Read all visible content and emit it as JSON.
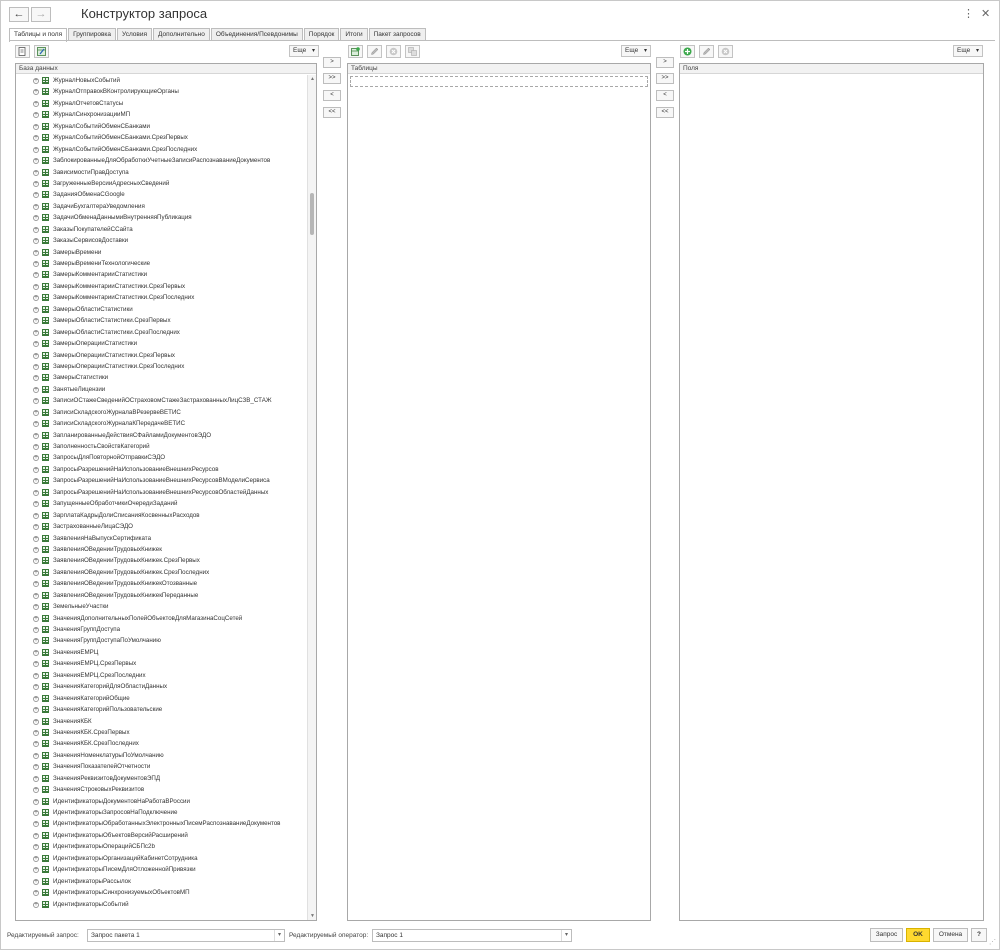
{
  "window": {
    "title": "Конструктор запроса"
  },
  "tabs": [
    "Таблицы и поля",
    "Группировка",
    "Условия",
    "Дополнительно",
    "Объединения/Псевдонимы",
    "Порядок",
    "Итоги",
    "Пакет запросов"
  ],
  "left_panel": {
    "more_label": "Еще",
    "header": "База данных",
    "items": [
      "ЖурналНовыхСобытий",
      "ЖурналОтправокВКонтролирующиеОрганы",
      "ЖурналОтчетовСтатусы",
      "ЖурналСинхронизацииМП",
      "ЖурналСобытийОбменСБанками",
      "ЖурналСобытийОбменСБанками.СрезПервых",
      "ЖурналСобытийОбменСБанками.СрезПоследних",
      "ЗаблокированныеДляОбработкиУчетныеЗаписиРаспознаваниеДокументов",
      "ЗависимостиПравДоступа",
      "ЗагруженныеВерсииАдресныхСведений",
      "ЗаданияОбменаСGoogle",
      "ЗадачиБухгалтераУведомления",
      "ЗадачиОбменаДаннымиВнутренняяПубликация",
      "ЗаказыПокупателейССайта",
      "ЗаказыСервисовДоставки",
      "ЗамерыВремени",
      "ЗамерыВремениТехнологические",
      "ЗамерыКомментарииСтатистики",
      "ЗамерыКомментарииСтатистики.СрезПервых",
      "ЗамерыКомментарииСтатистики.СрезПоследних",
      "ЗамерыОбластиСтатистики",
      "ЗамерыОбластиСтатистики.СрезПервых",
      "ЗамерыОбластиСтатистики.СрезПоследних",
      "ЗамерыОперацииСтатистики",
      "ЗамерыОперацииСтатистики.СрезПервых",
      "ЗамерыОперацииСтатистики.СрезПоследних",
      "ЗамерыСтатистики",
      "ЗанятыеЛицензии",
      "ЗаписиОСтажеСведенийОСтраховомСтажеЗастрахованныхЛицСЗВ_СТАЖ",
      "ЗаписиСкладскогоЖурналаВРезервеВЕТИС",
      "ЗаписиСкладскогоЖурналаКПередачеВЕТИС",
      "ЗапланированныеДействияСФайламиДокументовЭДО",
      "ЗаполненностьСвойствКатегорий",
      "ЗапросыДляПовторнойОтправкиСЭДО",
      "ЗапросыРазрешенийНаИспользованиеВнешнихРесурсов",
      "ЗапросыРазрешенийНаИспользованиеВнешнихРесурсовВМоделиСервиса",
      "ЗапросыРазрешенийНаИспользованиеВнешнихРесурсовОбластейДанных",
      "ЗапущенныеОбработчикиОчередиЗаданий",
      "ЗарплатаКадрыДолиСписанияКосвенныхРасходов",
      "ЗастрахованныеЛицаСЭДО",
      "ЗаявленияНаВыпускСертификата",
      "ЗаявленияОВеденииТрудовыхКнижек",
      "ЗаявленияОВеденииТрудовыхКнижек.СрезПервых",
      "ЗаявленияОВеденииТрудовыхКнижек.СрезПоследних",
      "ЗаявленияОВеденииТрудовыхКнижекОтозванные",
      "ЗаявленияОВеденииТрудовыхКнижекПереданные",
      "ЗемельныеУчастки",
      "ЗначенияДополнительныхПолейОбъектовДляМагазинаСоцСетей",
      "ЗначенияГруппДоступа",
      "ЗначенияГруппДоступаПоУмолчанию",
      "ЗначенияЕМРЦ",
      "ЗначенияЕМРЦ.СрезПервых",
      "ЗначенияЕМРЦ.СрезПоследних",
      "ЗначенияКатегорийДляОбластиДанных",
      "ЗначенияКатегорийОбщие",
      "ЗначенияКатегорийПользовательские",
      "ЗначенияКБК",
      "ЗначенияКБК.СрезПервых",
      "ЗначенияКБК.СрезПоследних",
      "ЗначенияНоменклатурыПоУмолчанию",
      "ЗначенияПоказателейОтчетности",
      "ЗначенияРеквизитовДокументовЭПД",
      "ЗначенияСтроковыхРеквизитов",
      "ИдентификаторыДокументовНаРаботаВРоссии",
      "ИдентификаторыЗапросовНаПодключение",
      "ИдентификаторыОбработанныхЭлектронныхПисемРаспознаваниеДокументов",
      "ИдентификаторыОбъектовВерсийРасширений",
      "ИдентификаторыОперацийСБПс2b",
      "ИдентификаторыОрганизацийКабинетСотрудника",
      "ИдентификаторыПисемДляОтложеннойПривязки",
      "ИдентификаторыРассылок",
      "ИдентификаторыСинхронизуемыхОбъектовМП",
      "ИдентификаторыСобытий"
    ]
  },
  "middle_panel": {
    "more_label": "Еще",
    "header": "Таблицы"
  },
  "right_panel": {
    "more_label": "Еще",
    "header": "Поля"
  },
  "move_buttons": {
    "add": ">",
    "add_all": ">>",
    "remove": "<",
    "remove_all": "<<"
  },
  "bottom": {
    "query_label": "Редактируемый запрос:",
    "query_value": "Запрос пакета 1",
    "operator_label": "Редактируемый оператор:",
    "operator_value": "Запрос 1",
    "btn_query": "Запрос",
    "btn_ok": "OK",
    "btn_cancel": "Отмена",
    "btn_help": "?"
  },
  "colors": {
    "ok_button": "#ffd92f",
    "table_icon": "#3a7a3a",
    "add_icon": "#3aa84a"
  }
}
